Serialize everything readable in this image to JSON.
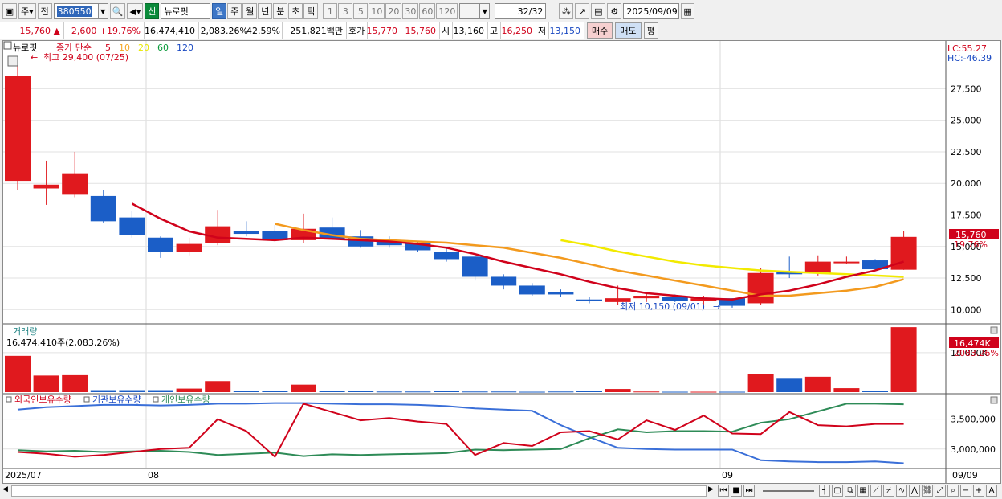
{
  "toolbar": {
    "period_unit": "주",
    "jeon_label": "전",
    "stock_code": "380550",
    "new_badge": "신",
    "stock_name": "뉴로핏",
    "period_buttons": [
      "일",
      "주",
      "월",
      "년",
      "분",
      "초",
      "틱"
    ],
    "selected_period": "일",
    "interval_buttons": [
      "1",
      "3",
      "5",
      "10",
      "20",
      "30",
      "60",
      "120"
    ],
    "count_display": "32",
    "count_total": "/32",
    "date_value": "2025/09/09"
  },
  "quote": {
    "price": "15,760",
    "direction_symbol": "▲",
    "change": "2,600",
    "change_pct": "+19.76%",
    "volume": "16,474,410",
    "volume_pct": "2,083.26%",
    "turnover_pct": "42.59%",
    "trade_value": "251,821백만",
    "ask_label": "호가",
    "ask_price": "15,770",
    "bid_price": "15,760",
    "open_label": "시",
    "open": "13,160",
    "high_label": "고",
    "high": "16,250",
    "low_label": "저",
    "low": "13,150",
    "buy_label": "매수",
    "sell_label": "매도",
    "eval_label": "평"
  },
  "price_panel": {
    "tab_label": "뉴로핏",
    "legend_title": "종가 단순",
    "ma_periods": [
      "5",
      "10",
      "20",
      "60",
      "120"
    ],
    "ma_colors": [
      "#d0021b",
      "#f5a623",
      "#e8e800",
      "#0a9a3a",
      "#1a49c2"
    ],
    "high_annotation": "최고 29,400 (07/25)",
    "low_annotation": "최저 10,150 (09/01)",
    "lc_label": "LC:55.27",
    "hc_label": "HC:-46.39",
    "y_ticks": [
      "27,500",
      "25,000",
      "22,500",
      "20,000",
      "17,500",
      "15,000",
      "12,500",
      "10,000"
    ],
    "current_price_tag": "15,760",
    "current_pct_tag": "19.76%"
  },
  "volume_panel": {
    "title": "거래량",
    "summary": "16,474,410주(2,083.26%)",
    "y_tick": "10,000K",
    "current_tag": "16,474K",
    "current_pct": "2083.26%"
  },
  "holdings_panel": {
    "legend": [
      {
        "label": "외국인보유수량",
        "color": "#d0021b"
      },
      {
        "label": "기관보유수량",
        "color": "#1a49c2"
      },
      {
        "label": "개인보유수량",
        "color": "#2e8b57"
      }
    ],
    "y_ticks": [
      "3,500,000",
      "3,000,000"
    ]
  },
  "x_axis": {
    "labels": [
      "2025/07",
      "08",
      "09",
      "09/09"
    ]
  },
  "chart_data": {
    "type": "candlestick",
    "ylim": [
      9000,
      29500
    ],
    "candles": [
      {
        "o": 20200,
        "h": 29400,
        "l": 19500,
        "c": 28500
      },
      {
        "o": 19600,
        "h": 21800,
        "l": 18300,
        "c": 19900
      },
      {
        "o": 19100,
        "h": 22500,
        "l": 18900,
        "c": 20800
      },
      {
        "o": 19000,
        "h": 19500,
        "l": 16900,
        "c": 17000
      },
      {
        "o": 17300,
        "h": 17800,
        "l": 15700,
        "c": 15900
      },
      {
        "o": 15700,
        "h": 15800,
        "l": 14100,
        "c": 14600
      },
      {
        "o": 14600,
        "h": 15700,
        "l": 14300,
        "c": 15200
      },
      {
        "o": 15300,
        "h": 17900,
        "l": 15100,
        "c": 16600
      },
      {
        "o": 16200,
        "h": 17000,
        "l": 15800,
        "c": 16000
      },
      {
        "o": 16200,
        "h": 16700,
        "l": 15400,
        "c": 15500
      },
      {
        "o": 15500,
        "h": 17600,
        "l": 15300,
        "c": 16400
      },
      {
        "o": 16500,
        "h": 17300,
        "l": 15600,
        "c": 15600
      },
      {
        "o": 15800,
        "h": 16300,
        "l": 14900,
        "c": 15000
      },
      {
        "o": 15400,
        "h": 15800,
        "l": 14900,
        "c": 15100
      },
      {
        "o": 15300,
        "h": 15400,
        "l": 14600,
        "c": 14700
      },
      {
        "o": 14600,
        "h": 14900,
        "l": 13800,
        "c": 14000
      },
      {
        "o": 14200,
        "h": 14500,
        "l": 12300,
        "c": 12600
      },
      {
        "o": 12600,
        "h": 12800,
        "l": 11600,
        "c": 11900
      },
      {
        "o": 11900,
        "h": 12100,
        "l": 11100,
        "c": 11200
      },
      {
        "o": 11400,
        "h": 11600,
        "l": 11000,
        "c": 11200
      },
      {
        "o": 10800,
        "h": 11000,
        "l": 10500,
        "c": 10700
      },
      {
        "o": 10600,
        "h": 11900,
        "l": 10400,
        "c": 10900
      },
      {
        "o": 10900,
        "h": 11300,
        "l": 10600,
        "c": 11100
      },
      {
        "o": 11000,
        "h": 11200,
        "l": 10600,
        "c": 10700
      },
      {
        "o": 10700,
        "h": 11100,
        "l": 10400,
        "c": 10900
      },
      {
        "o": 10900,
        "h": 10900,
        "l": 10150,
        "c": 10300
      },
      {
        "o": 10500,
        "h": 13300,
        "l": 10400,
        "c": 12900
      },
      {
        "o": 13000,
        "h": 14200,
        "l": 12500,
        "c": 12800
      },
      {
        "o": 12900,
        "h": 14300,
        "l": 12700,
        "c": 13800
      },
      {
        "o": 13700,
        "h": 14200,
        "l": 13600,
        "c": 13800
      },
      {
        "o": 13900,
        "h": 14000,
        "l": 13100,
        "c": 13200
      },
      {
        "o": 13160,
        "h": 16250,
        "l": 13150,
        "c": 15760
      }
    ],
    "ma5": [
      null,
      null,
      null,
      null,
      18400,
      17200,
      16200,
      15700,
      15600,
      15500,
      15700,
      15600,
      15500,
      15400,
      15200,
      14900,
      14400,
      13800,
      13300,
      12800,
      12200,
      11700,
      11300,
      11100,
      10900,
      10800,
      11200,
      11500,
      12000,
      12600,
      13100,
      13800
    ],
    "ma10": [
      null,
      null,
      null,
      null,
      null,
      null,
      null,
      null,
      null,
      16800,
      16300,
      15900,
      15600,
      15500,
      15400,
      15300,
      15100,
      14900,
      14500,
      14100,
      13600,
      13100,
      12700,
      12300,
      11900,
      11500,
      11100,
      11100,
      11300,
      11500,
      11800,
      12400
    ],
    "ma20": [
      null,
      null,
      null,
      null,
      null,
      null,
      null,
      null,
      null,
      null,
      null,
      null,
      null,
      null,
      null,
      null,
      null,
      null,
      null,
      15500,
      15100,
      14600,
      14200,
      13800,
      13500,
      13300,
      13100,
      13000,
      12900,
      12800,
      12700,
      12600
    ],
    "volume": [
      9200,
      4200,
      4300,
      500,
      500,
      500,
      900,
      2800,
      400,
      300,
      1900,
      250,
      250,
      150,
      150,
      250,
      150,
      150,
      100,
      150,
      250,
      800,
      150,
      100,
      100,
      100,
      4600,
      3400,
      3900,
      1000,
      300,
      16474
    ],
    "volume_ylim": [
      0,
      16500
    ],
    "holdings": {
      "foreign": [
        2950000,
        2920000,
        2870000,
        2900000,
        2950000,
        3000000,
        3020000,
        3500000,
        3300000,
        2870000,
        3760000,
        3620000,
        3480000,
        3520000,
        3460000,
        3420000,
        2900000,
        3100000,
        3050000,
        3280000,
        3300000,
        3160000,
        3480000,
        3320000,
        3560000,
        3260000,
        3250000,
        3620000,
        3400000,
        3380000,
        3420000,
        3420000
      ],
      "institution": [
        3660000,
        3700000,
        3720000,
        3740000,
        3740000,
        3730000,
        3740000,
        3760000,
        3760000,
        3770000,
        3770000,
        3760000,
        3750000,
        3750000,
        3740000,
        3720000,
        3680000,
        3660000,
        3640000,
        3400000,
        3200000,
        3020000,
        3000000,
        2990000,
        2990000,
        2990000,
        2810000,
        2790000,
        2780000,
        2780000,
        2790000,
        2760000
      ],
      "individual": [
        2980000,
        2960000,
        2970000,
        2950000,
        2960000,
        2970000,
        2950000,
        2900000,
        2920000,
        2940000,
        2880000,
        2910000,
        2900000,
        2910000,
        2920000,
        2930000,
        2990000,
        2980000,
        2990000,
        3000000,
        3180000,
        3330000,
        3280000,
        3300000,
        3300000,
        3290000,
        3440000,
        3500000,
        3630000,
        3760000,
        3760000,
        3750000
      ],
      "ylim": [
        2700000,
        3900000
      ]
    }
  }
}
